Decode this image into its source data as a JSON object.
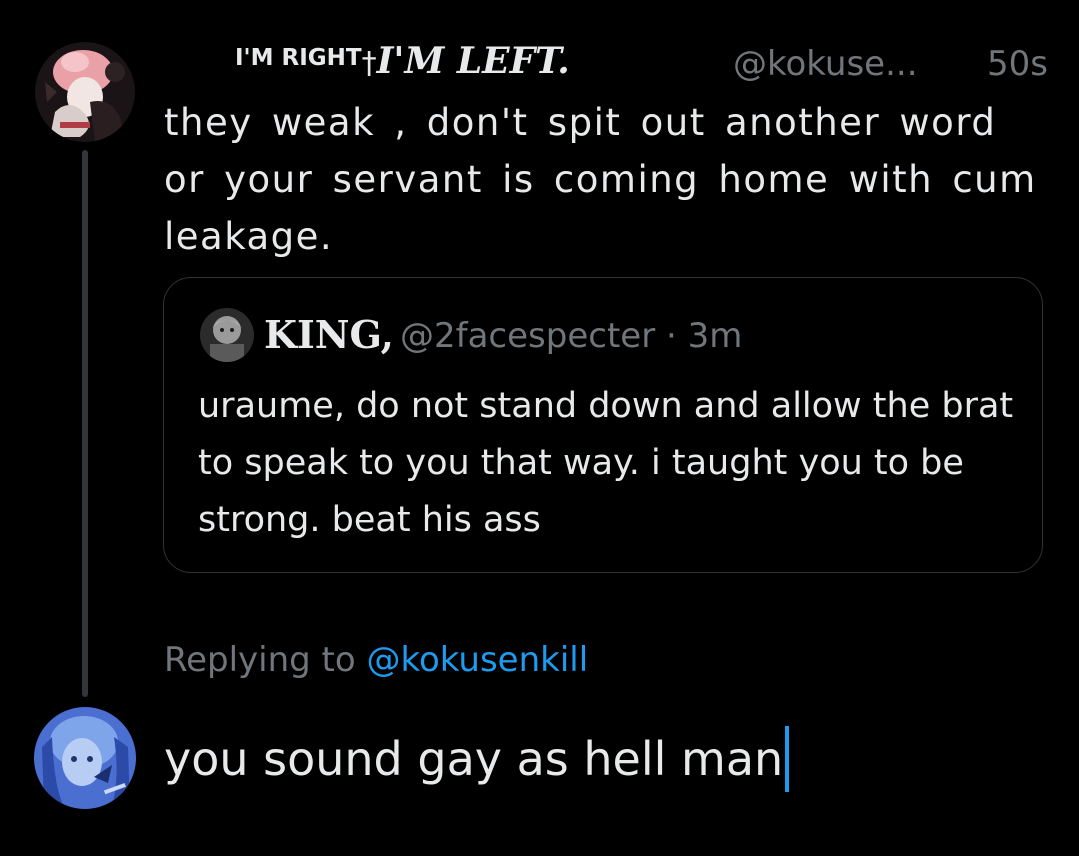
{
  "tweet": {
    "display_name_part1": "I'M RIGHT",
    "display_name_dagger": "†",
    "display_name_part2": "I'M LEFT.",
    "handle": "@kokuse...",
    "time": "50s",
    "text": "they weak , don't spit out another word or your servant is coming home with cum leakage.",
    "avatar_icon": "user-avatar-pink-anime"
  },
  "quote": {
    "name": "KING,",
    "handle": "@2facespecter",
    "separator": "·",
    "time": "3m",
    "text": "uraume, do not stand down and allow the brat to speak to you that way. i taught you to be strong. beat his ass",
    "avatar_icon": "user-avatar-grayscale"
  },
  "reply": {
    "prefix": "Replying to",
    "mention": "@kokusenkill"
  },
  "compose": {
    "text": "you sound gay as hell man",
    "avatar_icon": "user-avatar-blue-anime"
  },
  "colors": {
    "background": "#000000",
    "text": "#e7e9ea",
    "secondary": "#71767b",
    "accent": "#1d9bf0",
    "border": "#2f3336"
  }
}
